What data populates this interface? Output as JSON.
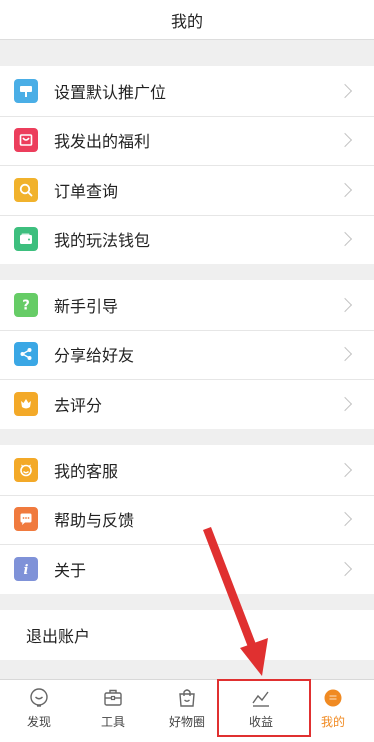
{
  "header": {
    "title": "我的"
  },
  "colors": {
    "settings": "#4aaee6",
    "welfare": "#ec3e5c",
    "orders": "#f1b22c",
    "wallet": "#3dbf7e",
    "guide": "#66cc66",
    "share": "#3aa7e5",
    "rate": "#f3a928",
    "service": "#f3a928",
    "help": "#f07a3e",
    "about": "#7f92d8",
    "active_tab": "#f08a22",
    "highlight": "#e03030"
  },
  "groups": [
    {
      "items": [
        {
          "label": "设置默认推广位",
          "icon": "settings-sign-icon"
        },
        {
          "label": "我发出的福利",
          "icon": "gift-bag-icon"
        },
        {
          "label": "订单查询",
          "icon": "search-icon"
        },
        {
          "label": "我的玩法钱包",
          "icon": "wallet-icon"
        }
      ]
    },
    {
      "items": [
        {
          "label": "新手引导",
          "icon": "question-icon"
        },
        {
          "label": "分享给好友",
          "icon": "share-icon"
        },
        {
          "label": "去评分",
          "icon": "flower-icon"
        }
      ]
    },
    {
      "items": [
        {
          "label": "我的客服",
          "icon": "customer-service-icon"
        },
        {
          "label": "帮助与反馈",
          "icon": "chat-bubble-icon"
        },
        {
          "label": "关于",
          "icon": "info-icon"
        }
      ]
    }
  ],
  "logout": {
    "label": "退出账户"
  },
  "tabbar": {
    "tabs": [
      {
        "label": "发现",
        "icon": "discover-icon"
      },
      {
        "label": "工具",
        "icon": "toolbox-icon"
      },
      {
        "label": "好物圈",
        "icon": "shopping-bag-icon"
      },
      {
        "label": "收益",
        "icon": "earnings-chart-icon"
      },
      {
        "label": "我的",
        "icon": "profile-icon"
      }
    ],
    "active": "我的"
  }
}
